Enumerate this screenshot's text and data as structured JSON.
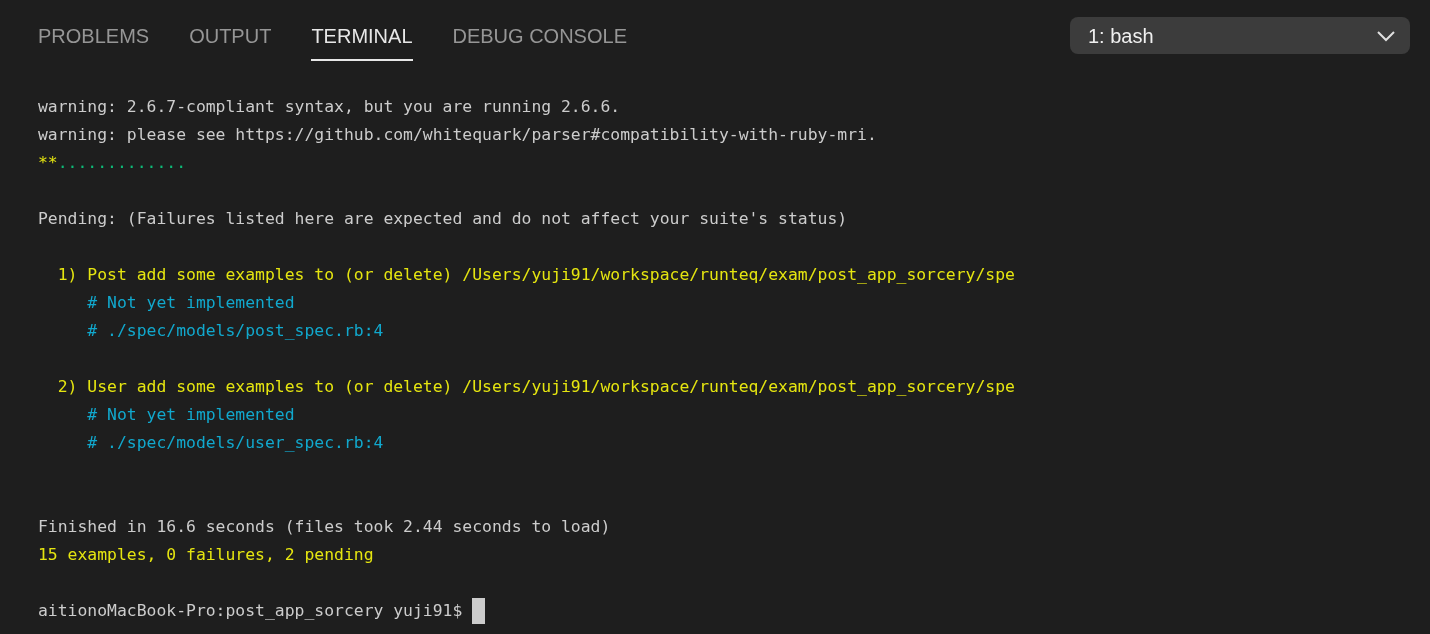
{
  "tabs": [
    {
      "label": "PROBLEMS",
      "selected": false
    },
    {
      "label": "OUTPUT",
      "selected": false
    },
    {
      "label": "TERMINAL",
      "selected": true
    },
    {
      "label": "DEBUG CONSOLE",
      "selected": false
    }
  ],
  "terminal_select": {
    "value": "1: bash"
  },
  "terminal_lines": [
    {
      "kind": "text",
      "segments": [
        {
          "kind": "output",
          "text": "warning: 2.6.7-compliant syntax, but you are running 2.6.6."
        }
      ]
    },
    {
      "kind": "text",
      "segments": [
        {
          "kind": "output",
          "text": "warning: please see https://github.com/whitequark/parser#compatibility-with-ruby-mri."
        }
      ]
    },
    {
      "kind": "text",
      "segments": [
        {
          "kind": "pending",
          "text": "**"
        },
        {
          "kind": "passed",
          "text": "............."
        }
      ]
    },
    {
      "kind": "blank"
    },
    {
      "kind": "text",
      "segments": [
        {
          "kind": "output",
          "text": "Pending: (Failures listed here are expected and do not affect your suite's status)"
        }
      ]
    },
    {
      "kind": "blank"
    },
    {
      "kind": "text",
      "segments": [
        {
          "kind": "pending",
          "text": "  1) Post add some examples to (or delete) /Users/yuji91/workspace/runteq/exam/post_app_sorcery/spe"
        }
      ]
    },
    {
      "kind": "text",
      "segments": [
        {
          "kind": "comment",
          "text": "     # Not yet implemented"
        }
      ]
    },
    {
      "kind": "text",
      "segments": [
        {
          "kind": "comment",
          "text": "     # ./spec/models/post_spec.rb:4"
        }
      ]
    },
    {
      "kind": "blank"
    },
    {
      "kind": "text",
      "segments": [
        {
          "kind": "pending",
          "text": "  2) User add some examples to (or delete) /Users/yuji91/workspace/runteq/exam/post_app_sorcery/spe"
        }
      ]
    },
    {
      "kind": "text",
      "segments": [
        {
          "kind": "comment",
          "text": "     # Not yet implemented"
        }
      ]
    },
    {
      "kind": "text",
      "segments": [
        {
          "kind": "comment",
          "text": "     # ./spec/models/user_spec.rb:4"
        }
      ]
    },
    {
      "kind": "blank"
    },
    {
      "kind": "blank"
    },
    {
      "kind": "text",
      "segments": [
        {
          "kind": "output",
          "text": "Finished in 16.6 seconds (files took 2.44 seconds to load)"
        }
      ]
    },
    {
      "kind": "text",
      "segments": [
        {
          "kind": "pending",
          "text": "15 examples, 0 failures, 2 pending"
        }
      ]
    },
    {
      "kind": "blank"
    },
    {
      "kind": "prompt",
      "text": "aitionoMacBook-Pro:post_app_sorcery yuji91$",
      "cursor": true
    }
  ]
}
